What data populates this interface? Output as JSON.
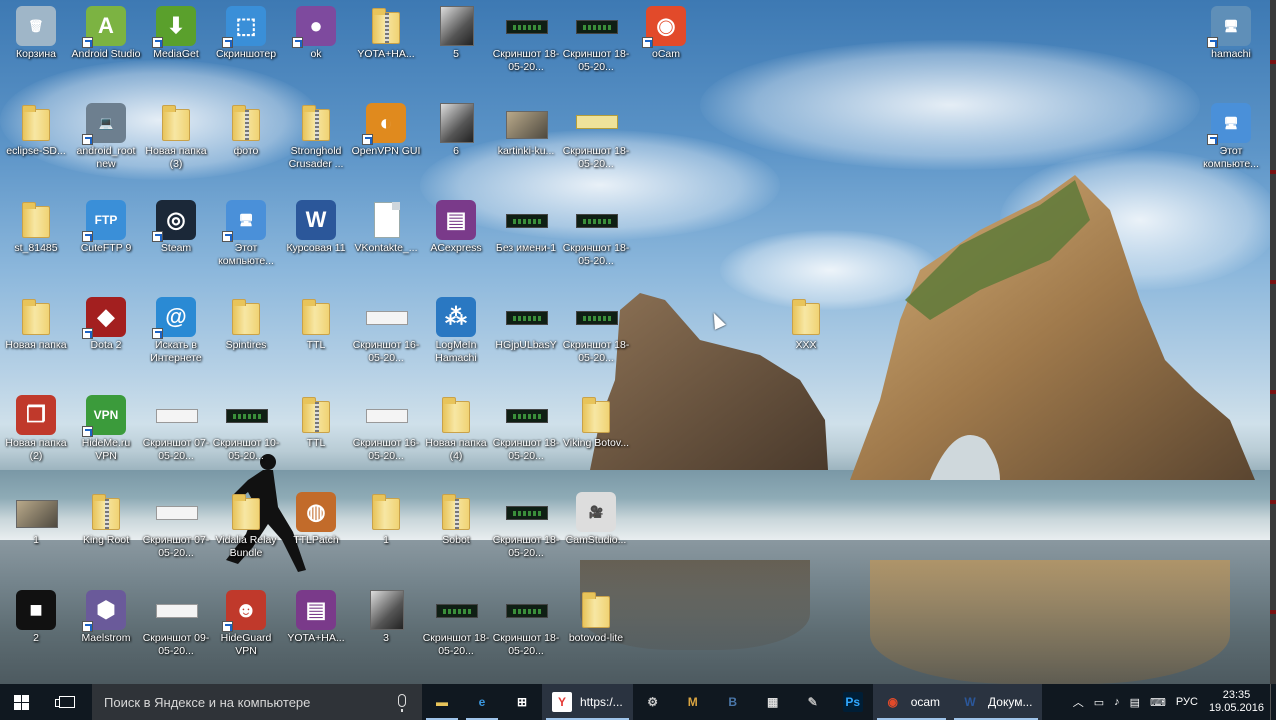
{
  "desktop": {
    "icons": [
      {
        "label": "Корзина",
        "icon": "recycle-bin-icon",
        "kind": "glyph",
        "glyph": "🗑",
        "color": "#9fb6c8",
        "shortcut": false
      },
      {
        "label": "Android Studio",
        "icon": "android-studio-icon",
        "kind": "glyph",
        "glyph": "A",
        "color": "#7cb342",
        "shortcut": true
      },
      {
        "label": "MediaGet",
        "icon": "mediaget-icon",
        "kind": "glyph",
        "glyph": "⬇",
        "color": "#5aa02c",
        "shortcut": true
      },
      {
        "label": "Скриншотер",
        "icon": "screenshoter-icon",
        "kind": "glyph",
        "glyph": "⬚",
        "color": "#3a8fd8",
        "shortcut": true
      },
      {
        "label": "ok",
        "icon": "tor-onion-icon",
        "kind": "glyph",
        "glyph": "●",
        "color": "#7e4a9e",
        "shortcut": true
      },
      {
        "label": "YOTA+HA...",
        "icon": "zip-folder-icon",
        "kind": "zipfolder",
        "shortcut": false
      },
      {
        "label": "5",
        "icon": "photo-icon",
        "kind": "photo",
        "shortcut": false
      },
      {
        "label": "Скриншот 18-05-20...",
        "icon": "screenshot-thumbnail-icon",
        "kind": "thumb",
        "shortcut": false
      },
      {
        "label": "Скриншот 18-05-20...",
        "icon": "screenshot-thumbnail-icon",
        "kind": "thumb",
        "shortcut": false
      },
      {
        "label": "oCam",
        "icon": "ocam-icon",
        "kind": "glyph",
        "glyph": "◉",
        "color": "#e24a2a",
        "shortcut": true
      },
      {
        "label": "hamachi",
        "icon": "computer-icon",
        "kind": "glyph",
        "glyph": "🖥",
        "color": "#5f8fb8",
        "shortcut": true
      },
      {
        "label": "eclipse-SD...",
        "icon": "folder-icon",
        "kind": "folder",
        "shortcut": false
      },
      {
        "label": "android_root new",
        "icon": "installer-icon",
        "kind": "glyph",
        "glyph": "💻",
        "color": "#6d7f8f",
        "shortcut": true
      },
      {
        "label": "Новая папка (3)",
        "icon": "folder-icon",
        "kind": "folder",
        "shortcut": false
      },
      {
        "label": "фото",
        "icon": "zip-folder-icon",
        "kind": "zipfolder",
        "shortcut": false
      },
      {
        "label": "Stronghold Crusader ...",
        "icon": "zip-folder-icon",
        "kind": "zipfolder",
        "shortcut": false
      },
      {
        "label": "OpenVPN GUI",
        "icon": "openvpn-icon",
        "kind": "glyph",
        "glyph": "◐",
        "color": "#e08a1e",
        "shortcut": true
      },
      {
        "label": "6",
        "icon": "photo-icon",
        "kind": "photo",
        "shortcut": false
      },
      {
        "label": "kartinki-ku...",
        "icon": "photo-icon",
        "kind": "thumbphoto",
        "shortcut": false
      },
      {
        "label": "Скриншот 18-05-20...",
        "icon": "screenshot-thumbnail-icon",
        "kind": "thumbyellow",
        "shortcut": false
      },
      {
        "label": "Этот компьюте...",
        "icon": "this-pc-icon",
        "kind": "glyph",
        "glyph": "🖥",
        "color": "#4a90d9",
        "shortcut": true
      },
      {
        "label": "st_81485",
        "icon": "folder-icon",
        "kind": "folder",
        "shortcut": false
      },
      {
        "label": "CuteFTP 9",
        "icon": "cuteftp-icon",
        "kind": "glyph",
        "glyph": "FTP",
        "color": "#3a8fd8",
        "shortcut": true
      },
      {
        "label": "Steam",
        "icon": "steam-icon",
        "kind": "glyph",
        "glyph": "◎",
        "color": "#1b2838",
        "shortcut": true
      },
      {
        "label": "Этот компьюте...",
        "icon": "this-pc-icon",
        "kind": "glyph",
        "glyph": "🖥",
        "color": "#4a90d9",
        "shortcut": true
      },
      {
        "label": "Курсовая 11",
        "icon": "word-document-icon",
        "kind": "glyph",
        "glyph": "W",
        "color": "#2b579a",
        "shortcut": false
      },
      {
        "label": "VKontakte_...",
        "icon": "file-icon",
        "kind": "doc",
        "shortcut": false
      },
      {
        "label": "ACexpress",
        "icon": "winrar-icon",
        "kind": "glyph",
        "glyph": "▤",
        "color": "#7a3a8a",
        "shortcut": false
      },
      {
        "label": "Без имени-1",
        "icon": "screenshot-thumbnail-icon",
        "kind": "thumb",
        "shortcut": false
      },
      {
        "label": "Скриншот 18-05-20...",
        "icon": "screenshot-thumbnail-icon",
        "kind": "thumb",
        "shortcut": false
      },
      {
        "label": "Новая папка",
        "icon": "folder-icon",
        "kind": "folder",
        "shortcut": false
      },
      {
        "label": "Dota 2",
        "icon": "dota2-icon",
        "kind": "glyph",
        "glyph": "◆",
        "color": "#a31f1f",
        "shortcut": true
      },
      {
        "label": "Искать в Интернете",
        "icon": "search-internet-icon",
        "kind": "glyph",
        "glyph": "@",
        "color": "#2a8ad4",
        "shortcut": true
      },
      {
        "label": "Spintires",
        "icon": "folder-icon",
        "kind": "folder",
        "shortcut": false
      },
      {
        "label": "TTL",
        "icon": "folder-icon",
        "kind": "folder",
        "shortcut": false
      },
      {
        "label": "Скриншот 16-05-20...",
        "icon": "screenshot-thumbnail-icon",
        "kind": "thumbwhite",
        "shortcut": false
      },
      {
        "label": "LogMeIn Hamachi",
        "icon": "hamachi-icon",
        "kind": "glyph",
        "glyph": "⁂",
        "color": "#2a78c2",
        "shortcut": false
      },
      {
        "label": "HGjpULbasY",
        "icon": "screenshot-thumbnail-icon",
        "kind": "thumb",
        "shortcut": false
      },
      {
        "label": "Скриншот 18-05-20...",
        "icon": "screenshot-thumbnail-icon",
        "kind": "thumb",
        "shortcut": false
      },
      {
        "label": "XXX",
        "icon": "folder-icon",
        "kind": "folder",
        "shortcut": false
      },
      {
        "label": "Новая папка (2)",
        "icon": "folder-icon",
        "kind": "glyph",
        "glyph": "❐",
        "color": "#c0392b",
        "shortcut": false
      },
      {
        "label": "HideMe.ru VPN",
        "icon": "vpn-shield-icon",
        "kind": "glyph",
        "glyph": "VPN",
        "color": "#3b9b3b",
        "shortcut": true
      },
      {
        "label": "Скриншот 07-05-20...",
        "icon": "screenshot-thumbnail-icon",
        "kind": "thumbwhite",
        "shortcut": false
      },
      {
        "label": "Скриншот 10-05-20...",
        "icon": "screenshot-thumbnail-icon",
        "kind": "thumb",
        "shortcut": false
      },
      {
        "label": "TTL",
        "icon": "zip-folder-icon",
        "kind": "zipfolder",
        "shortcut": false
      },
      {
        "label": "Скриншот 16-05-20...",
        "icon": "screenshot-thumbnail-icon",
        "kind": "thumbwhite",
        "shortcut": false
      },
      {
        "label": "Новая папка (4)",
        "icon": "folder-icon",
        "kind": "folder",
        "shortcut": false
      },
      {
        "label": "Скриншот 18-05-20...",
        "icon": "screenshot-thumbnail-icon",
        "kind": "thumb",
        "shortcut": false
      },
      {
        "label": "Viking Botov...",
        "icon": "folder-icon",
        "kind": "folder",
        "shortcut": false
      },
      {
        "label": "1",
        "icon": "photo-icon",
        "kind": "thumbphoto",
        "shortcut": false
      },
      {
        "label": "King Root",
        "icon": "zip-folder-icon",
        "kind": "zipfolder",
        "shortcut": false
      },
      {
        "label": "Скриншот 07-05-20...",
        "icon": "screenshot-thumbnail-icon",
        "kind": "thumbwhite",
        "shortcut": false
      },
      {
        "label": "Vidalia Relay Bundle",
        "icon": "folder-icon",
        "kind": "folder",
        "shortcut": false
      },
      {
        "label": "TTLPatch",
        "icon": "ttlpatch-icon",
        "kind": "glyph",
        "glyph": "◍",
        "color": "#c26b2a",
        "shortcut": false
      },
      {
        "label": "1",
        "icon": "folder-icon",
        "kind": "folder",
        "shortcut": false
      },
      {
        "label": "Sobot",
        "icon": "zip-folder-icon",
        "kind": "zipfolder",
        "shortcut": false
      },
      {
        "label": "Скриншот 18-05-20...",
        "icon": "screenshot-thumbnail-icon",
        "kind": "thumb",
        "shortcut": false
      },
      {
        "label": "CamStudio...",
        "icon": "camstudio-icon",
        "kind": "glyph",
        "glyph": "🎥",
        "color": "#dddddd",
        "shortcut": false
      },
      {
        "label": "2",
        "icon": "photo-icon",
        "kind": "glyph",
        "glyph": "■",
        "color": "#111111",
        "shortcut": false
      },
      {
        "label": "Maelstrom",
        "icon": "maelstrom-icon",
        "kind": "glyph",
        "glyph": "⬢",
        "color": "#6a5a9a",
        "shortcut": true
      },
      {
        "label": "Скриншот 09-05-20...",
        "icon": "screenshot-thumbnail-icon",
        "kind": "thumbwhite",
        "shortcut": false
      },
      {
        "label": "HideGuard VPN",
        "icon": "ninja-icon",
        "kind": "glyph",
        "glyph": "☻",
        "color": "#c0392b",
        "shortcut": true
      },
      {
        "label": "YOTA+HA...",
        "icon": "winrar-icon",
        "kind": "glyph",
        "glyph": "▤",
        "color": "#7a3a8a",
        "shortcut": false
      },
      {
        "label": "3",
        "icon": "photo-icon",
        "kind": "photo",
        "shortcut": false
      },
      {
        "label": "Скриншот 18-05-20...",
        "icon": "screenshot-thumbnail-icon",
        "kind": "thumb",
        "shortcut": false
      },
      {
        "label": "Скриншот 18-05-20...",
        "icon": "screenshot-thumbnail-icon",
        "kind": "thumb",
        "shortcut": false
      },
      {
        "label": "botovod-lite",
        "icon": "folder-icon",
        "kind": "folder",
        "shortcut": false
      }
    ]
  },
  "taskbar": {
    "search_placeholder": "Поиск в Яндексе и на компьютере",
    "apps": [
      {
        "name": "file-explorer",
        "icon": "folder-icon",
        "glyph": "▬",
        "color": "#e8c45a",
        "label": ""
      },
      {
        "name": "edge",
        "icon": "edge-icon",
        "glyph": "e",
        "color": "#3a96dd",
        "label": ""
      },
      {
        "name": "store",
        "icon": "store-icon",
        "glyph": "⊞",
        "color": "#ffffff",
        "label": ""
      },
      {
        "name": "yandex-browser",
        "icon": "yandex-browser-icon",
        "glyph": "Y",
        "color": "#e53935",
        "label": "https:/..."
      },
      {
        "name": "app-gear",
        "icon": "gear-icon",
        "glyph": "⚙",
        "color": "#cccccc",
        "label": ""
      },
      {
        "name": "app-m",
        "icon": "m-app-icon",
        "glyph": "M",
        "color": "#d9a441",
        "label": ""
      },
      {
        "name": "vk",
        "icon": "vk-icon",
        "glyph": "B",
        "color": "#4a76a8",
        "label": ""
      },
      {
        "name": "calculator",
        "icon": "calculator-icon",
        "glyph": "▦",
        "color": "#dddddd",
        "label": ""
      },
      {
        "name": "app-misc",
        "icon": "tool-icon",
        "glyph": "✎",
        "color": "#bbbbbb",
        "label": ""
      },
      {
        "name": "photoshop",
        "icon": "photoshop-icon",
        "glyph": "Ps",
        "color": "#31a8ff",
        "label": ""
      },
      {
        "name": "ocam",
        "icon": "ocam-icon",
        "glyph": "◉",
        "color": "#e24a2a",
        "label": "ocam"
      },
      {
        "name": "word",
        "icon": "word-icon",
        "glyph": "W",
        "color": "#2b579a",
        "label": "Докум..."
      }
    ],
    "tray": {
      "language": "РУС",
      "time": "23:35",
      "date": "19.05.2016"
    }
  }
}
